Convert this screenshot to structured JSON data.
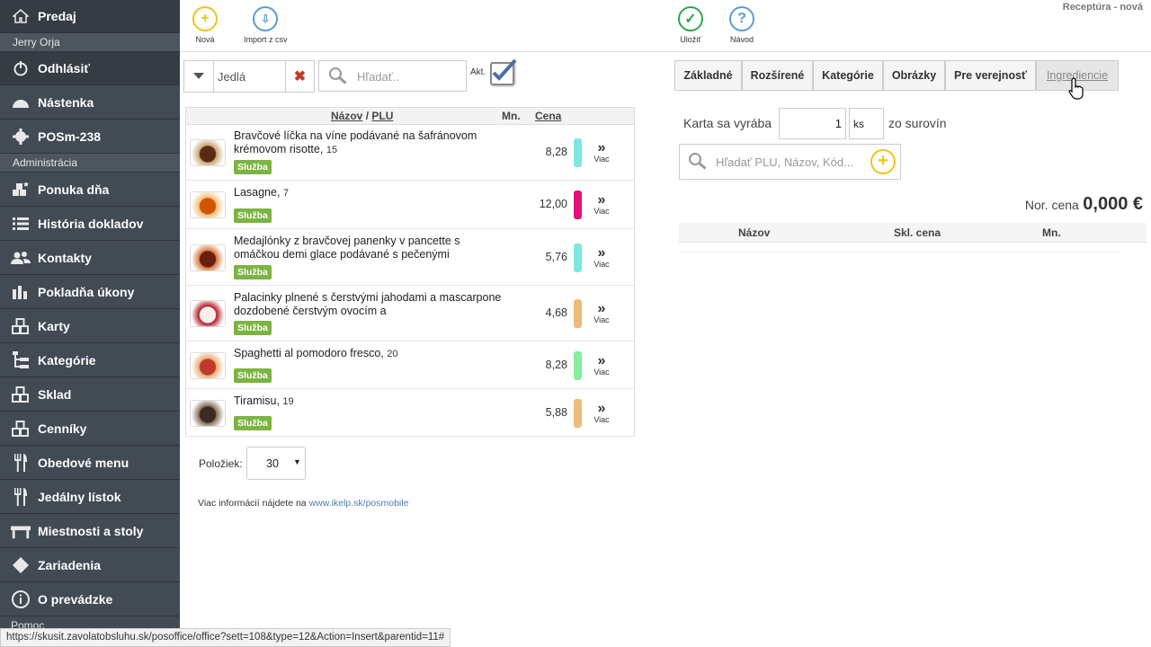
{
  "sidebar": {
    "top": {
      "label": "Predaj",
      "icon": "home-icon"
    },
    "user": "Jerry Orja",
    "logout": {
      "label": "Odhlásiť",
      "icon": "power-icon"
    },
    "dashboard": {
      "label": "Nástenka",
      "icon": "dashboard-icon"
    },
    "device": {
      "label": "POSm-238",
      "icon": "gear-icon"
    },
    "admin_header": "Administrácia",
    "items": [
      {
        "label": "Ponuka dňa",
        "icon": "cubes-star-icon"
      },
      {
        "label": "História dokladov",
        "icon": "list-icon"
      },
      {
        "label": "Kontakty",
        "icon": "users-icon"
      },
      {
        "label": "Pokladňa úkony",
        "icon": "bar-chart-icon"
      },
      {
        "label": "Karty",
        "icon": "cubes-icon"
      },
      {
        "label": "Kategórie",
        "icon": "sitemap-icon"
      },
      {
        "label": "Sklad",
        "icon": "cubes-icon"
      },
      {
        "label": "Cenníky",
        "icon": "cubes-icon"
      },
      {
        "label": "Obedové menu",
        "icon": "cutlery-icon"
      },
      {
        "label": "Jedálny lístok",
        "icon": "cutlery-icon"
      },
      {
        "label": "Miestnosti a stoly",
        "icon": "table-icon"
      },
      {
        "label": "Zariadenia",
        "icon": "diamond-icon"
      },
      {
        "label": "O prevádzke",
        "icon": "info-icon"
      }
    ],
    "bottom_partial": "Pomoc"
  },
  "toolbar": {
    "new_label": "Nová",
    "import_label": "Import z csv",
    "save_label": "Uložiť",
    "help_label": "Návod",
    "doc_title": "Receptúra - nová"
  },
  "filter": {
    "category": "Jedlá",
    "search_placeholder": "Hľadať..",
    "active_label": "Akt.",
    "active_checked": true
  },
  "table": {
    "col_name": "Názov",
    "col_sep": "/",
    "col_plu": "PLU",
    "col_qty": "Mn.",
    "col_price": "Cena",
    "more_label": "Viac",
    "rows": [
      {
        "name": "Bravčové líčka na víne podávané na šafránovom krémovom risotte,",
        "plu": "15",
        "badge": "Služba",
        "price": "8,28",
        "color": "#7de8df"
      },
      {
        "name": "Lasagne,",
        "plu": "7",
        "badge": "Služba",
        "price": "12,00",
        "color": "#e0137b"
      },
      {
        "name": "Medajlónky z bravčovej panenky v pancette s omáčkou demi glace podávané s pečenými",
        "plu": "",
        "badge": "Služba",
        "price": "5,76",
        "color": "#7de8df"
      },
      {
        "name": "Palacinky plnené s čerstvými jahodami a mascarpone dozdobené čerstvým ovocím a",
        "plu": "",
        "badge": "Služba",
        "price": "4,68",
        "color": "#edbb7a"
      },
      {
        "name": "Spaghetti al pomodoro fresco,",
        "plu": "20",
        "badge": "Služba",
        "price": "8,28",
        "color": "#86ee9c"
      },
      {
        "name": "Tiramisu,",
        "plu": "19",
        "badge": "Služba",
        "price": "5,88",
        "color": "#edbb7a"
      }
    ]
  },
  "pager": {
    "label": "Položiek:",
    "value": "30"
  },
  "info": {
    "text": "Viac informácií nájdete na",
    "link": "www.ikelp.sk/posmobile"
  },
  "tabs": [
    "Základné",
    "Rozšírené",
    "Kategórie",
    "Obrázky",
    "Pre verejnosť",
    "Ingrediencie"
  ],
  "recipe": {
    "card_label": "Karta sa vyrába",
    "qty": "1",
    "unit": "ks",
    "suffix": "zo surovín",
    "search_placeholder": "Hľadať PLU, Názov, Kód...",
    "price_label": "Nor. cena",
    "price_value": "0,000 €",
    "col_name": "Názov",
    "col_price": "Skl. cena",
    "col_qty": "Mn."
  },
  "status_url": "https://skusit.zavolatobsluhu.sk/posoffice/office?sett=108&type=12&Action=Insert&parentid=11#"
}
